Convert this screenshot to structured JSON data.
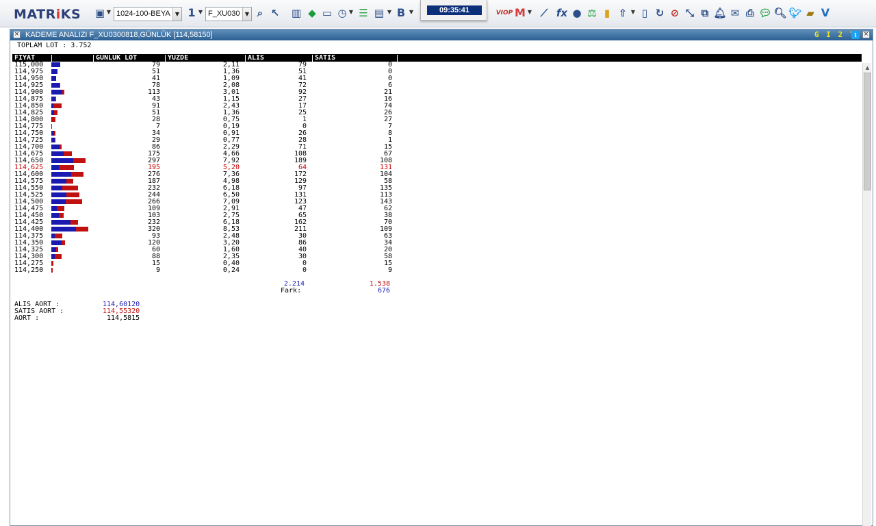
{
  "toolbar": {
    "logo_prefix": "MATR",
    "logo_dot": "i",
    "logo_suffix": "KS",
    "layout_select": "1024-100-BEYA",
    "window_number": "1",
    "symbol_select": "F_XU030",
    "clock": "09:35:41",
    "viop_label": "VIOP",
    "icons": [
      "save-icon",
      "magnifier-icon",
      "cursor-icon",
      "bar-chart-icon",
      "cube-icon",
      "monitor-icon",
      "clock-icon",
      "list-icon",
      "table-icon",
      "bold-icon",
      "text-color-icon",
      "viop-icon",
      "m-icon",
      "line-chart-icon",
      "formula-icon",
      "user-icon",
      "scales-icon",
      "traffic-light-icon",
      "upload-icon",
      "document-icon",
      "refresh-icon",
      "close-doc-icon",
      "resize-icon",
      "open-window-icon",
      "bell-icon",
      "mail-icon",
      "print-icon",
      "chat-icon",
      "search-icon",
      "twitter-icon",
      "book-icon",
      "v-icon"
    ]
  },
  "window": {
    "title": "KADEME ANALIZI F_XU0300818,GÜNLÜK [114,58150]",
    "gits": "G I 2 T S",
    "twitter_mini": "t"
  },
  "summary": {
    "total_lot_label": "TOPLAM LOT : ",
    "total_lot_value": "3.752",
    "alis_total": "2.214",
    "satis_total": "1.538",
    "fark_label": "Fark:",
    "fark_value": "676",
    "alis_aort_label": "ALIS AORT :",
    "alis_aort_value": "114,60120",
    "satis_aort_label": "SATIS AORT :",
    "satis_aort_value": "114,55320",
    "aort_label": "AORT :",
    "aort_value": "114,5815"
  },
  "columns": [
    "FİYAT",
    "",
    "GUNLUK LOT",
    "YUZDE",
    "ALIS",
    "SATIS"
  ],
  "colors": {
    "buy": "#1a1ab0",
    "sell": "#c01010",
    "highlight": "#cc0000",
    "text": "#000000"
  },
  "rows": [
    {
      "price": "115,000",
      "lot": "79",
      "pct": "2,11",
      "alis": "79",
      "satis": "0"
    },
    {
      "price": "114,975",
      "lot": "51",
      "pct": "1,36",
      "alis": "51",
      "satis": "0"
    },
    {
      "price": "114,950",
      "lot": "41",
      "pct": "1,09",
      "alis": "41",
      "satis": "0"
    },
    {
      "price": "114,925",
      "lot": "78",
      "pct": "2,08",
      "alis": "72",
      "satis": "6"
    },
    {
      "price": "114,900",
      "lot": "113",
      "pct": "3,01",
      "alis": "92",
      "satis": "21"
    },
    {
      "price": "114,875",
      "lot": "43",
      "pct": "1,15",
      "alis": "27",
      "satis": "16"
    },
    {
      "price": "114,850",
      "lot": "91",
      "pct": "2,43",
      "alis": "17",
      "satis": "74"
    },
    {
      "price": "114,825",
      "lot": "51",
      "pct": "1,36",
      "alis": "25",
      "satis": "26"
    },
    {
      "price": "114,800",
      "lot": "28",
      "pct": "0,75",
      "alis": "1",
      "satis": "27"
    },
    {
      "price": "114,775",
      "lot": "7",
      "pct": "0,19",
      "alis": "0",
      "satis": "7"
    },
    {
      "price": "114,750",
      "lot": "34",
      "pct": "0,91",
      "alis": "26",
      "satis": "8"
    },
    {
      "price": "114,725",
      "lot": "29",
      "pct": "0,77",
      "alis": "28",
      "satis": "1"
    },
    {
      "price": "114,700",
      "lot": "86",
      "pct": "2,29",
      "alis": "71",
      "satis": "15"
    },
    {
      "price": "114,675",
      "lot": "175",
      "pct": "4,66",
      "alis": "108",
      "satis": "67"
    },
    {
      "price": "114,650",
      "lot": "297",
      "pct": "7,92",
      "alis": "189",
      "satis": "108"
    },
    {
      "price": "114,625",
      "lot": "195",
      "pct": "5,20",
      "alis": "64",
      "satis": "131",
      "highlight": true
    },
    {
      "price": "114,600",
      "lot": "276",
      "pct": "7,36",
      "alis": "172",
      "satis": "104"
    },
    {
      "price": "114,575",
      "lot": "187",
      "pct": "4,98",
      "alis": "129",
      "satis": "58"
    },
    {
      "price": "114,550",
      "lot": "232",
      "pct": "6,18",
      "alis": "97",
      "satis": "135"
    },
    {
      "price": "114,525",
      "lot": "244",
      "pct": "6,50",
      "alis": "131",
      "satis": "113"
    },
    {
      "price": "114,500",
      "lot": "266",
      "pct": "7,09",
      "alis": "123",
      "satis": "143"
    },
    {
      "price": "114,475",
      "lot": "109",
      "pct": "2,91",
      "alis": "47",
      "satis": "62"
    },
    {
      "price": "114,450",
      "lot": "103",
      "pct": "2,75",
      "alis": "65",
      "satis": "38"
    },
    {
      "price": "114,425",
      "lot": "232",
      "pct": "6,18",
      "alis": "162",
      "satis": "70"
    },
    {
      "price": "114,400",
      "lot": "320",
      "pct": "8,53",
      "alis": "211",
      "satis": "109"
    },
    {
      "price": "114,375",
      "lot": "93",
      "pct": "2,48",
      "alis": "30",
      "satis": "63"
    },
    {
      "price": "114,350",
      "lot": "120",
      "pct": "3,20",
      "alis": "86",
      "satis": "34"
    },
    {
      "price": "114,325",
      "lot": "60",
      "pct": "1,60",
      "alis": "40",
      "satis": "20"
    },
    {
      "price": "114,300",
      "lot": "88",
      "pct": "2,35",
      "alis": "30",
      "satis": "58"
    },
    {
      "price": "114,275",
      "lot": "15",
      "pct": "0,40",
      "alis": "0",
      "satis": "15"
    },
    {
      "price": "114,250",
      "lot": "9",
      "pct": "0,24",
      "alis": "0",
      "satis": "9"
    }
  ]
}
